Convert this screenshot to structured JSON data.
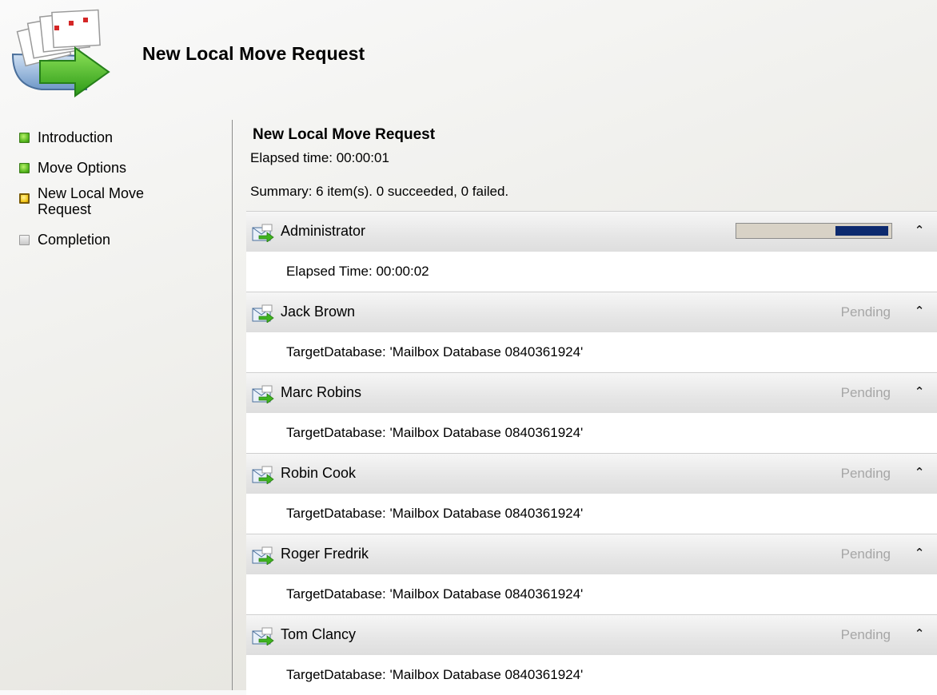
{
  "wizard": {
    "title": "New Local Move Request"
  },
  "sidebar": {
    "steps": [
      {
        "label": "Introduction",
        "state": "done"
      },
      {
        "label": "Move Options",
        "state": "done"
      },
      {
        "label": "New Local Move Request",
        "state": "current"
      },
      {
        "label": "Completion",
        "state": "pending"
      }
    ]
  },
  "main": {
    "heading": "New Local Move Request",
    "elapsed": "Elapsed time: 00:00:01",
    "summary": "Summary: 6 item(s). 0 succeeded, 0 failed.",
    "items": [
      {
        "name": "Administrator",
        "status": "",
        "progress": 0.35,
        "detail": "Elapsed Time: 00:00:02"
      },
      {
        "name": "Jack Brown",
        "status": "Pending",
        "detail": "TargetDatabase: 'Mailbox Database 0840361924'"
      },
      {
        "name": "Marc Robins",
        "status": "Pending",
        "detail": "TargetDatabase: 'Mailbox Database 0840361924'"
      },
      {
        "name": "Robin Cook",
        "status": "Pending",
        "detail": "TargetDatabase: 'Mailbox Database 0840361924'"
      },
      {
        "name": "Roger Fredrik",
        "status": "Pending",
        "detail": "TargetDatabase: 'Mailbox Database 0840361924'"
      },
      {
        "name": "Tom Clancy",
        "status": "Pending",
        "detail": "TargetDatabase: 'Mailbox Database 0840361924'"
      }
    ],
    "collapse_glyph": "⌃"
  },
  "colors": {
    "step_done": "#4fb11a",
    "step_current": "#f2c413",
    "progress_fill": "#0d2a6e",
    "pending_text": "#a6a6a6"
  }
}
